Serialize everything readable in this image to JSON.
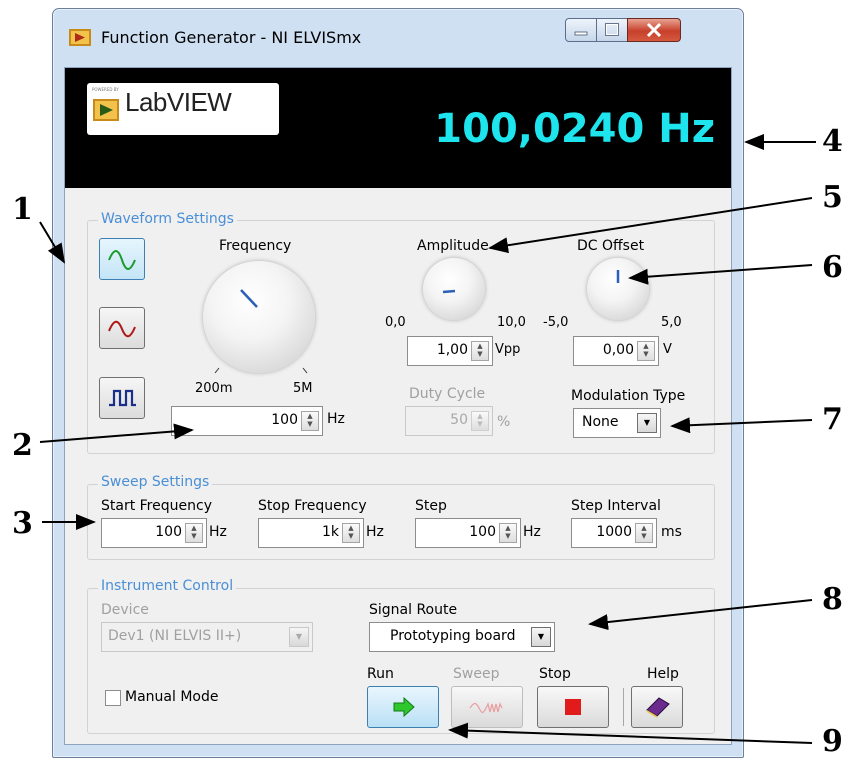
{
  "window": {
    "title": "Function Generator - NI ELVISmx",
    "minimize_icon": "minimize-icon",
    "maximize_icon": "maximize-icon",
    "close_icon": "close-icon"
  },
  "display": {
    "logo_text": "LabVIEW",
    "frequency_readout": "100,0240 Hz"
  },
  "waveform": {
    "group_title": "Waveform Settings",
    "buttons": [
      {
        "icon": "sine-wave-icon",
        "active": true
      },
      {
        "icon": "triangle-wave-icon",
        "active": false
      },
      {
        "icon": "square-wave-icon",
        "active": false
      }
    ],
    "frequency": {
      "label": "Frequency",
      "min_label": "200m",
      "max_label": "5M",
      "value": "100",
      "unit": "Hz"
    },
    "amplitude": {
      "label": "Amplitude",
      "min_label": "0,0",
      "max_label": "10,0",
      "value": "1,00",
      "unit": "Vpp"
    },
    "dc_offset": {
      "label": "DC Offset",
      "min_label": "-5,0",
      "max_label": "5,0",
      "value": "0,00",
      "unit": "V"
    },
    "duty_cycle": {
      "label": "Duty Cycle",
      "value": "50",
      "unit": "%"
    },
    "modulation": {
      "label": "Modulation Type",
      "value": "None"
    }
  },
  "sweep": {
    "group_title": "Sweep Settings",
    "start": {
      "label": "Start Frequency",
      "value": "100",
      "unit": "Hz"
    },
    "stop": {
      "label": "Stop Frequency",
      "value": "1k",
      "unit": "Hz"
    },
    "step": {
      "label": "Step",
      "value": "100",
      "unit": "Hz"
    },
    "interval": {
      "label": "Step Interval",
      "value": "1000",
      "unit": "ms"
    }
  },
  "instrument": {
    "group_title": "Instrument Control",
    "device_label": "Device",
    "device_value": "Dev1 (NI ELVIS II+)",
    "route_label": "Signal Route",
    "route_value": "Prototyping board",
    "manual_mode_label": "Manual Mode",
    "run_label": "Run",
    "sweep_label": "Sweep",
    "stop_label": "Stop",
    "help_label": "Help"
  },
  "annotations": [
    "1",
    "2",
    "3",
    "4",
    "5",
    "6",
    "7",
    "8",
    "9"
  ],
  "colors": {
    "display_text": "#1ee4ee",
    "group_title": "#4a8fd6",
    "run_arrow": "#2ec82e",
    "stop_square": "#e11b1b"
  }
}
